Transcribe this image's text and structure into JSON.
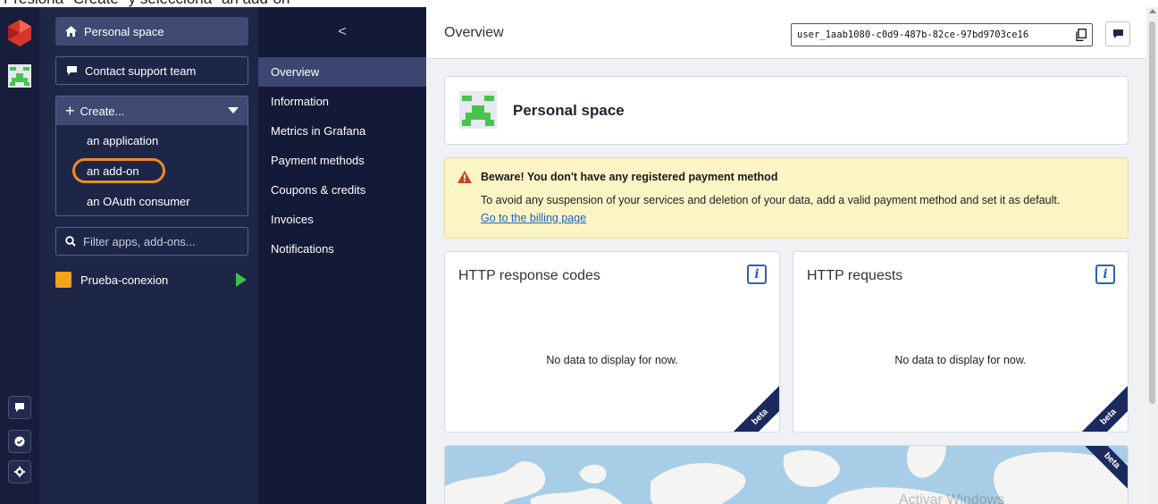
{
  "top_caption": "Presiona \"Create\" y selecciona \"an add-on\"",
  "sidebar": {
    "personal_space": "Personal space",
    "contact_support": "Contact support team",
    "create_label": "Create...",
    "create_items": [
      "an application",
      "an add-on",
      "an OAuth consumer"
    ],
    "filter_placeholder": "Filter apps, add-ons...",
    "apps": [
      {
        "name": "Prueba-conexion"
      }
    ]
  },
  "submenu": {
    "back": "<",
    "items": [
      "Overview",
      "Information",
      "Metrics in Grafana",
      "Payment methods",
      "Coupons & credits",
      "Invoices",
      "Notifications"
    ],
    "active": "Overview"
  },
  "main": {
    "title": "Overview",
    "user_id": "user_1aab1080-c0d9-487b-82ce-97bd9703ce16",
    "personal_card_title": "Personal space",
    "warning": {
      "title": "Beware! You don't have any registered payment method",
      "text": "To avoid any suspension of your services and deletion of your data, add a valid payment method and set it as default.",
      "link": "Go to the billing page"
    },
    "stats": [
      {
        "title": "HTTP response codes",
        "empty": "No data to display for now.",
        "badge": "beta"
      },
      {
        "title": "HTTP requests",
        "empty": "No data to display for now.",
        "badge": "beta"
      }
    ],
    "map_badge": "beta",
    "watermark": "Activar Windows"
  },
  "colors": {
    "rail": "#171d3b",
    "sidebar": "#1e2648",
    "submenu": "#131936",
    "highlight_ring": "#f08a24",
    "warning_bg": "#fbf4c5",
    "link": "#1a63c7"
  }
}
